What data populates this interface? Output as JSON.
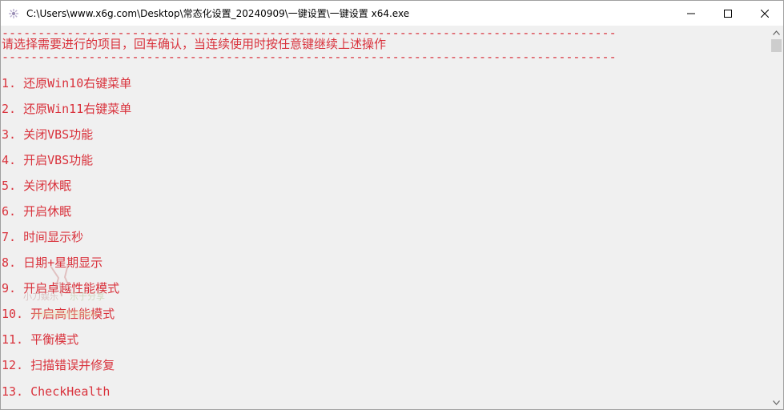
{
  "window": {
    "title": "C:\\Users\\www.x6g.com\\Desktop\\常态化设置_20240909\\一键设置\\一键设置 x64.exe",
    "icon": "console-app-icon",
    "controls": [
      "minimize-icon",
      "maximize-icon",
      "close-icon"
    ]
  },
  "console": {
    "separator": "-------------------------------------------------------------------------------------",
    "prompt": "请选择需要进行的项目，回车确认，当连续使用时按任意键继续上述操作",
    "menu_items": [
      "1. 还原Win10右键菜单",
      "2. 还原Win11右键菜单",
      "3. 关闭VBS功能",
      "4. 开启VBS功能",
      "5. 关闭休眠",
      "6. 开启休眠",
      "7. 时间显示秒",
      "8. 日期+星期显示",
      "9. 开启卓越性能模式",
      "10. 开启高性能模式",
      "11. 平衡模式",
      "12. 扫描错误并修复",
      "13. CheckHealth"
    ],
    "text_color": "#d9323c",
    "background": "#f0f0f0"
  },
  "watermark": {
    "text_left": "小刀娱乐",
    "text_right": "乐于分享"
  }
}
